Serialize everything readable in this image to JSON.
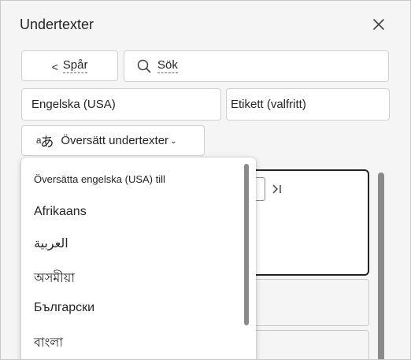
{
  "panel": {
    "title": "Undertexter"
  },
  "toolbar": {
    "back_chevron": "<",
    "back_label": "Spår",
    "search_placeholder": "Sök"
  },
  "fields": {
    "language_value": "Engelska (USA)",
    "label_value": "Etikett (valfritt)"
  },
  "translate": {
    "icon_text": "ᵃあ",
    "label": "Översätt undertexter",
    "caret": "⌄"
  },
  "dropdown": {
    "header": "Översätta engelska (USA) till",
    "items": [
      {
        "label": "Afrikaans"
      },
      {
        "label": "العربية"
      },
      {
        "label": "অসমীয়া"
      },
      {
        "label": "Български"
      },
      {
        "label": "বাংলা"
      }
    ]
  },
  "icons": {
    "close": "close-icon",
    "search": "search-icon",
    "skip_end": "skip-to-end-icon",
    "translate": "translate-icon"
  }
}
